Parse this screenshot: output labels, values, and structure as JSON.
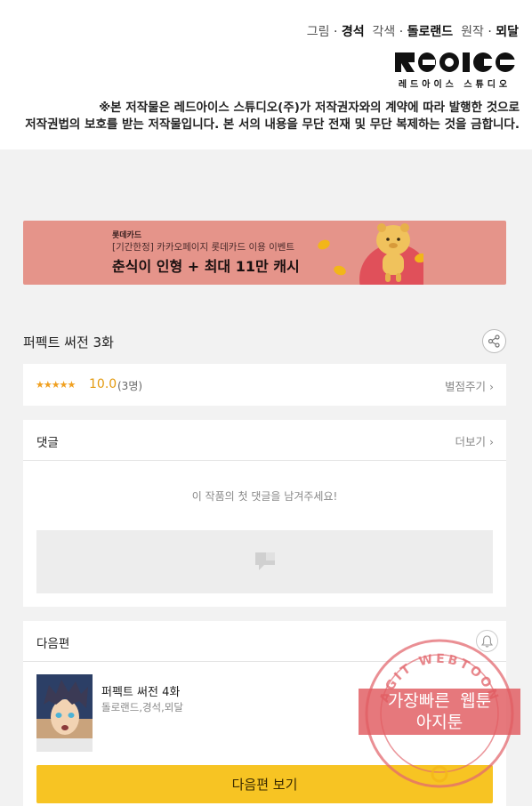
{
  "credits": {
    "art_role": "그림",
    "art_name": "경석",
    "adapt_role": "각색",
    "adapt_name": "돌로랜드",
    "original_role": "원작",
    "original_name": "뫼달",
    "logo_word": "REDICE",
    "logo_sub": "레드아이스 스튜디오",
    "notice_line1": "※본 저작물은 레드아이스 스튜디오(주)가 저작권자와의 계약에 따라 발행한 것으로",
    "notice_line2": "저작권법의 보호를 받는 저작물입니다. 본 서의 내용을 무단 전재 및 무단 복제하는 것을 금합니다."
  },
  "banner": {
    "brand": "롯데카드",
    "subtitle": "[기간한정] 카카오페이지 롯데카드 이용 이벤트",
    "title": "춘식이 인형 + 최대 11만 캐시",
    "bg_color": "#e5948a"
  },
  "episode": {
    "title": "퍼펙트 써전 3화"
  },
  "rating": {
    "stars": "★★★★★",
    "score": "10.0",
    "count": "(3명)",
    "rate_link": "별점주기"
  },
  "comments": {
    "header": "댓글",
    "more": "더보기",
    "empty_message": "이 작품의 첫 댓글을 남겨주세요!"
  },
  "next": {
    "header": "다음편",
    "title": "퍼펙트 써전 4화",
    "meta": "돌로랜드,경석,뫼달",
    "button": "다음편 보기",
    "button_color": "#f7c423"
  },
  "watermark": {
    "ring_text": "AGIT WEBTOON",
    "line1": "가장빠른 웹툰",
    "line2": "아지툰"
  },
  "chevron": "›"
}
